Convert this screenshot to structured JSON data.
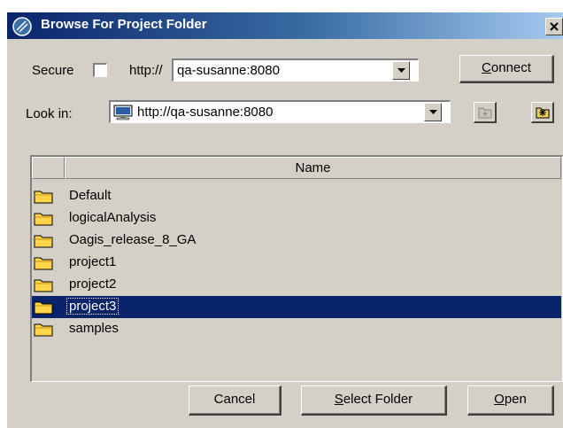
{
  "window": {
    "title": "Browse For Project Folder"
  },
  "connection": {
    "secure_label": "Secure",
    "secure_checked": false,
    "protocol_prefix": "http://",
    "host_value": "qa-susanne:8080",
    "connect_label": "Connect",
    "connect_mnemonic": "C"
  },
  "look_in": {
    "label": "Look in:",
    "value": "http://qa-susanne:8080"
  },
  "list": {
    "column_header": "Name",
    "items": [
      {
        "name": "Default",
        "selected": false
      },
      {
        "name": "logicalAnalysis",
        "selected": false
      },
      {
        "name": "Oagis_release_8_GA",
        "selected": false
      },
      {
        "name": "project1",
        "selected": false
      },
      {
        "name": "project2",
        "selected": false
      },
      {
        "name": "project3",
        "selected": true
      },
      {
        "name": "samples",
        "selected": false
      }
    ]
  },
  "buttons": {
    "cancel": "Cancel",
    "select_folder": "Select Folder",
    "open": "Open"
  },
  "colors": {
    "titlebar_start": "#0a246a",
    "titlebar_end": "#a6caf0",
    "selection": "#0a246a",
    "dialog_bg": "#d4d0c8",
    "folder": "#ffd54a"
  },
  "icons": {
    "title": "app-logo-icon",
    "close": "close-icon",
    "look_in": "computer-icon",
    "up": "up-folder-icon",
    "new": "new-folder-icon",
    "row": "folder-icon"
  }
}
